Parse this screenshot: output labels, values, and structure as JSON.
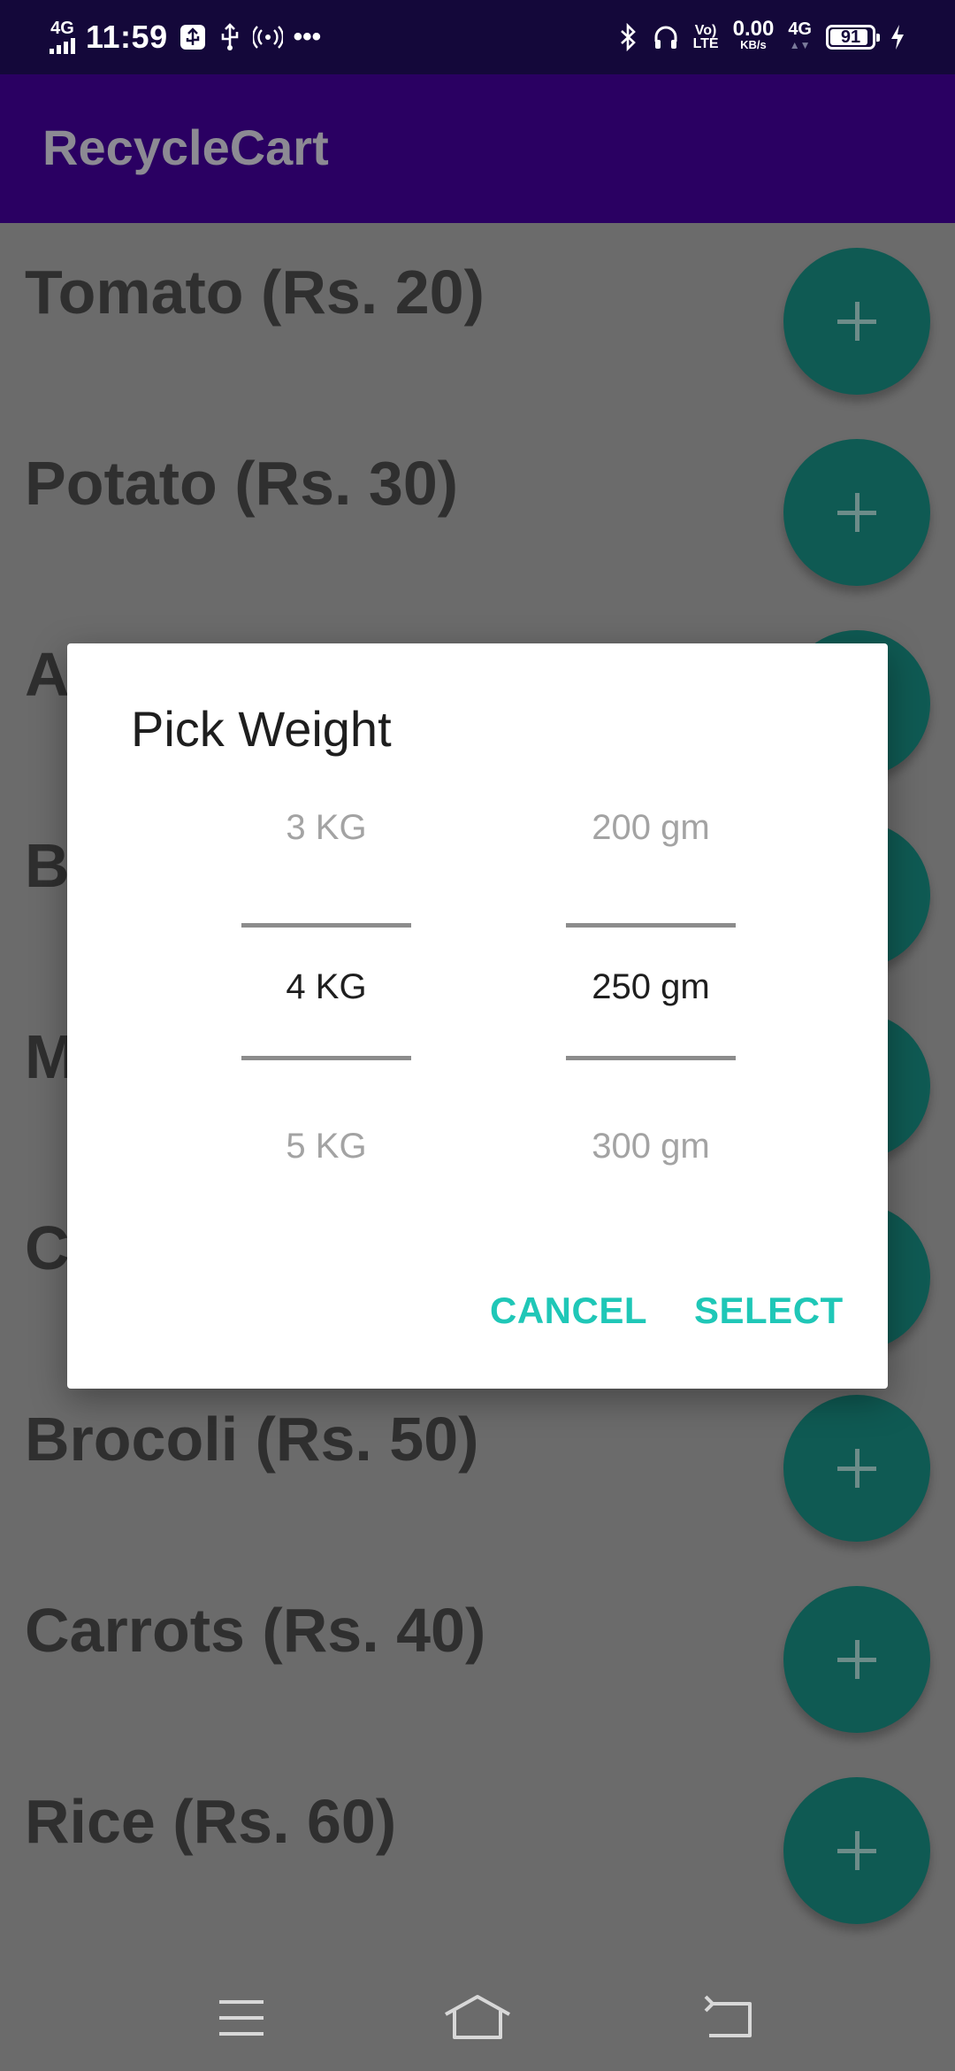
{
  "status_bar": {
    "network_left": "4G",
    "time": "11:59",
    "more": "•••",
    "volte_top": "Vo)",
    "volte_bottom": "LTE",
    "speed_value": "0.00",
    "speed_unit": "KB/s",
    "network_right": "4G",
    "battery_level": 91
  },
  "app_bar": {
    "title": "RecycleCart"
  },
  "list": {
    "items": [
      {
        "label": "Tomato (Rs. 20)"
      },
      {
        "label": "Potato (Rs. 30)"
      },
      {
        "label": "A"
      },
      {
        "label": "B"
      },
      {
        "label": "M"
      },
      {
        "label": "C"
      },
      {
        "label": "Brocoli (Rs. 50)"
      },
      {
        "label": "Carrots (Rs. 40)"
      },
      {
        "label": "Rice (Rs. 60)"
      }
    ]
  },
  "dialog": {
    "title": "Pick Weight",
    "kg_picker": {
      "prev": "3 KG",
      "current": "4 KG",
      "next": "5 KG"
    },
    "gm_picker": {
      "prev": "200 gm",
      "current": "250 gm",
      "next": "300 gm"
    },
    "cancel_label": "CANCEL",
    "select_label": "SELECT"
  },
  "colors": {
    "status_bar": "#14083a",
    "app_bar": "#2a0062",
    "fab": "#0f5a53",
    "dialog_accent": "#1fc7b7"
  },
  "icons": [
    "signal-icon",
    "usb-icon",
    "hotspot-icon",
    "bluetooth-icon",
    "headphones-icon",
    "battery-icon",
    "charging-icon",
    "plus-icon",
    "menu-icon",
    "home-icon",
    "back-icon"
  ]
}
